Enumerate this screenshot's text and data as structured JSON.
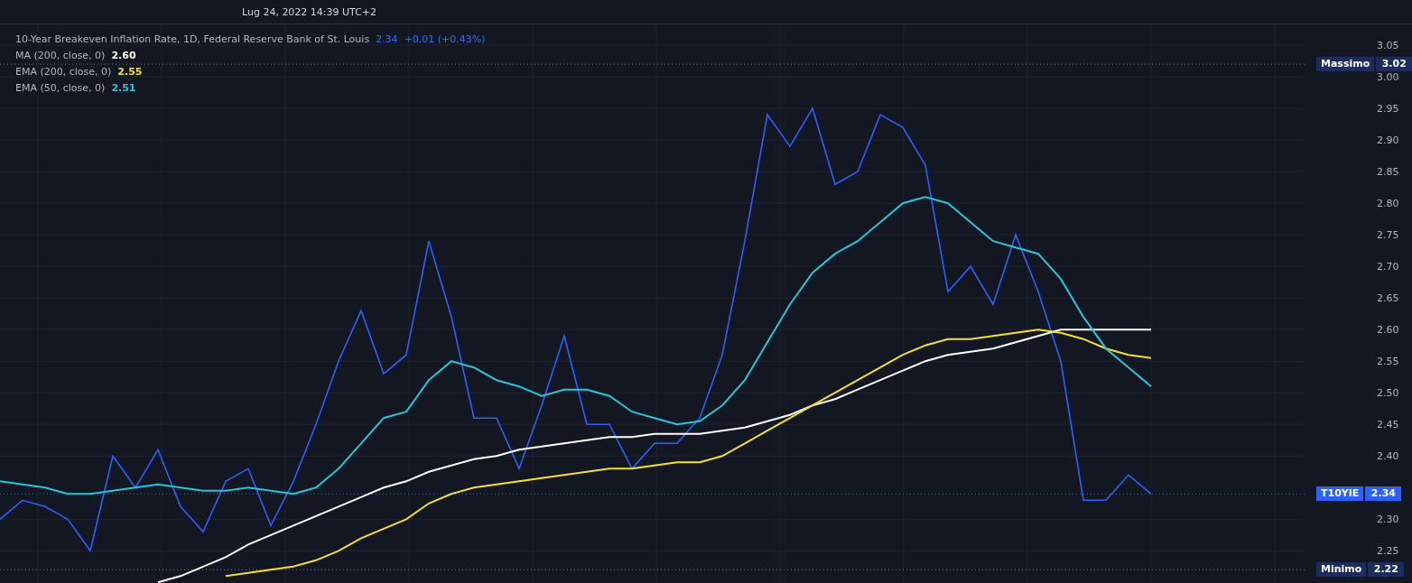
{
  "header": {
    "datetime": "Lug 24, 2022 14:39 UTC+2"
  },
  "legend": {
    "title": "10-Year Breakeven Inflation Rate, 1D, Federal Reserve Bank of St. Louis",
    "price": "2.34",
    "change": "+0.01 (+0.43%)",
    "indicators": [
      {
        "name": "MA (200, close, 0)",
        "value": "2.60",
        "color": "#ffffff"
      },
      {
        "name": "EMA (200, close, 0)",
        "value": "2.55",
        "color": "#f5e12c"
      },
      {
        "name": "EMA (50, close, 0)",
        "value": "2.51",
        "color": "#26c6da"
      }
    ]
  },
  "price_axis": {
    "ticks": [
      "3.05",
      "3.00",
      "2.95",
      "2.90",
      "2.85",
      "2.80",
      "2.75",
      "2.70",
      "2.65",
      "2.60",
      "2.55",
      "2.50",
      "2.45",
      "2.40",
      "2.30",
      "2.25"
    ],
    "markers": [
      {
        "kind": "high",
        "label": "Massimo",
        "value": "3.02"
      },
      {
        "kind": "last",
        "label": "T10YIE",
        "value": "2.34"
      },
      {
        "kind": "low",
        "label": "Minimo",
        "value": "2.22"
      }
    ]
  }
}
